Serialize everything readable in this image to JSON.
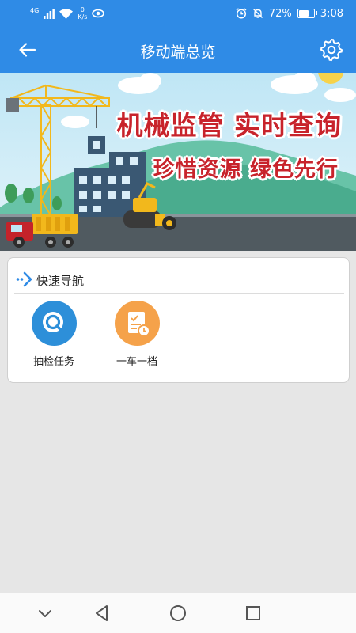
{
  "status_bar": {
    "signal_label": "4G",
    "net_speed_value": "0",
    "net_speed_unit": "K/s",
    "battery_percent": "72%",
    "battery_level": 0.72,
    "time": "3:08"
  },
  "nav": {
    "title": "移动端总览"
  },
  "banner": {
    "slogan_line1": "机械监管 实时查询",
    "slogan_line2": "珍惜资源 绿色先行"
  },
  "quick_nav": {
    "title": "快速导航",
    "items": [
      {
        "label": "抽检任务",
        "icon": "search-icon",
        "color": "#2d8fd9"
      },
      {
        "label": "一车一档",
        "icon": "document-clock-icon",
        "color": "#f5a24a"
      }
    ]
  },
  "colors": {
    "primary": "#2f8be6",
    "slogan": "#c8232b"
  }
}
